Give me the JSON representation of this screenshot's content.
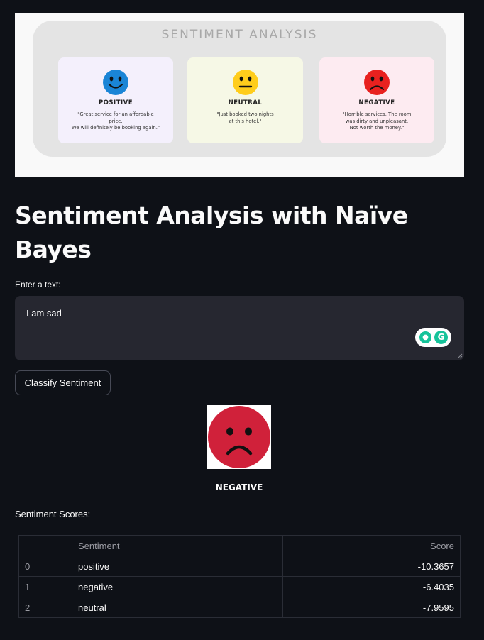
{
  "banner": {
    "title": "SENTIMENT ANALYSIS",
    "cards": [
      {
        "label": "POSITIVE",
        "quote_line1": "\"Great service for an affordable",
        "quote_line2": "price.",
        "quote_line3": "We will definitely be booking again.\"",
        "color": "#1a85d6"
      },
      {
        "label": "NEUTRAL",
        "quote_line1": "\"Just booked two nights",
        "quote_line2": "at this hotel.\"",
        "quote_line3": "",
        "color": "#ffcd1c"
      },
      {
        "label": "NEGATIVE",
        "quote_line1": "\"Horrible services. The room",
        "quote_line2": "was dirty and unpleasant.",
        "quote_line3": "Not worth the money.\"",
        "color": "#e8211f"
      }
    ]
  },
  "page": {
    "title": "Sentiment Analysis with Naïve Bayes"
  },
  "input": {
    "label": "Enter a text:",
    "value": "I am sad"
  },
  "actions": {
    "classify_label": "Classify Sentiment"
  },
  "result": {
    "label": "NEGATIVE",
    "icon": "sad-face-icon",
    "color": "#d0213a"
  },
  "scores": {
    "label": "Sentiment Scores:",
    "columns": [
      "",
      "Sentiment",
      "Score"
    ],
    "rows": [
      {
        "index": "0",
        "sentiment": "positive",
        "score": "-10.3657"
      },
      {
        "index": "1",
        "sentiment": "negative",
        "score": "-6.4035"
      },
      {
        "index": "2",
        "sentiment": "neutral",
        "score": "-7.9595"
      }
    ]
  }
}
